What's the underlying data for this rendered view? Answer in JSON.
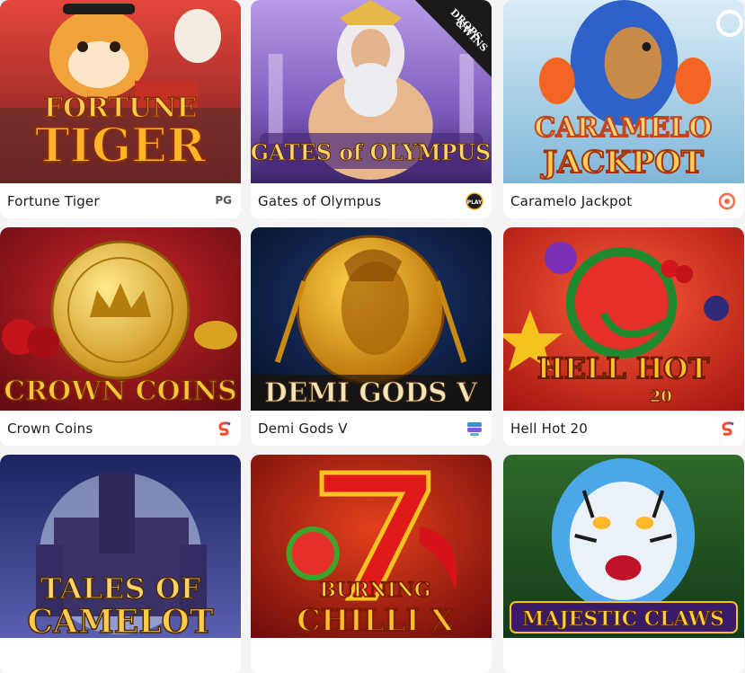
{
  "games": [
    {
      "name": "Fortune Tiger",
      "title_art": [
        "FORTUNE",
        "TIGER"
      ],
      "provider_label": "PG",
      "provider_icon": "pg-logo-icon"
    },
    {
      "name": "Gates of Olympus",
      "title_art": [
        "GATES of OLYMPUS"
      ],
      "badge_lines": [
        "DROPS",
        "&WINS"
      ],
      "provider_label": "PLAY",
      "provider_icon": "pragmatic-play-logo-icon"
    },
    {
      "name": "Caramelo Jackpot",
      "title_art": [
        "CARAMELO",
        "JACKPOT"
      ],
      "provider_icon": "provider-ring-logo-icon"
    },
    {
      "name": "Crown Coins",
      "title_art": [
        "CROWN COINS"
      ],
      "provider_icon": "provider-s-logo-icon"
    },
    {
      "name": "Demi Gods V",
      "title_art": [
        "DEMI GODS V"
      ],
      "provider_icon": "provider-stack-logo-icon"
    },
    {
      "name": "Hell Hot 20",
      "title_art": [
        "HELL HOT",
        "20"
      ],
      "provider_icon": "provider-s-logo-icon"
    },
    {
      "name": "Tales of Camelot",
      "title_art": [
        "TALES OF",
        "CAMELOT"
      ]
    },
    {
      "name": "Burning Chilli X",
      "title_art": [
        "BURNING",
        "CHILLI X"
      ]
    },
    {
      "name": "Majestic Claws",
      "title_art": [
        "MAJESTIC CLAWS"
      ]
    }
  ],
  "colors": {
    "page_bg": "#f4f4f6",
    "card_bar_bg": "#ffffff",
    "name_text": "#1b1b22"
  }
}
